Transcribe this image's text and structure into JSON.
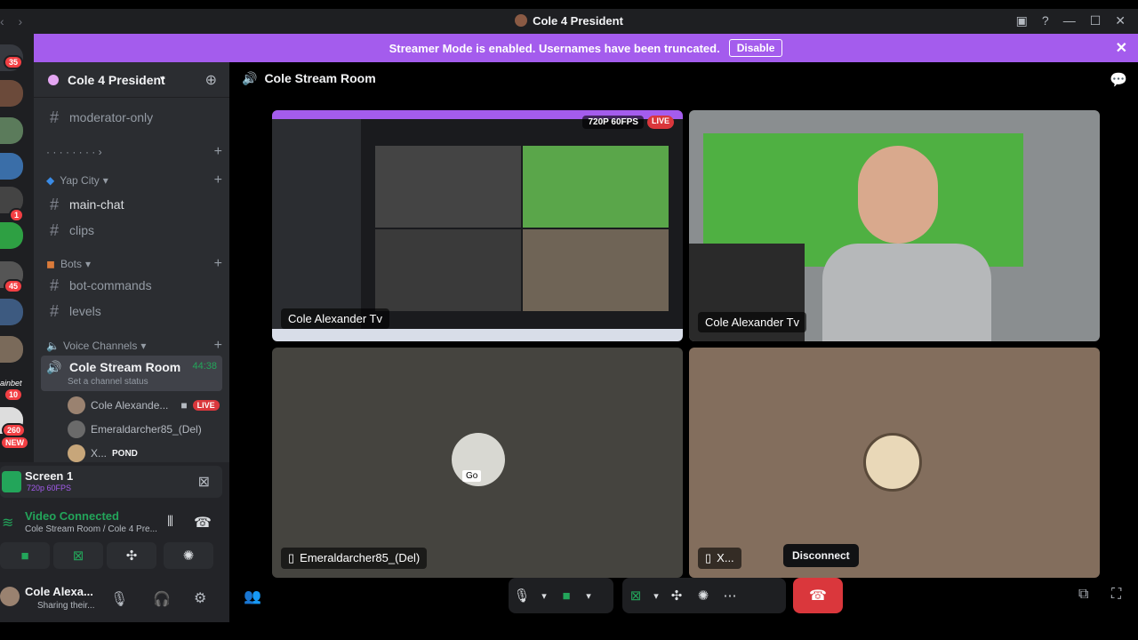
{
  "window": {
    "title": "Cole 4 President"
  },
  "banner": {
    "text": "Streamer Mode is enabled. Usernames have been truncated.",
    "button": "Disable"
  },
  "servers": {
    "badges": [
      "35",
      "1",
      "45",
      "10",
      "260",
      "NEW"
    ],
    "label_partial": "ainbet"
  },
  "server": {
    "name": "Cole 4 President"
  },
  "channels": {
    "moderator": "moderator-only",
    "dots": "· · · · · · · · ›",
    "cat_yap": "Yap City",
    "main_chat": "main-chat",
    "clips": "clips",
    "cat_bots": "Bots",
    "bot_commands": "bot-commands",
    "levels": "levels",
    "cat_voice": "Voice Channels",
    "voice_room": "Cole Stream Room",
    "timer": "44:38",
    "status": "Set a channel status",
    "members": [
      {
        "name": "Cole Alexande...",
        "live": "LIVE"
      },
      {
        "name": "Emeraldarcher85_(Del)"
      },
      {
        "name": "X...",
        "extra": "POND"
      }
    ]
  },
  "panel": {
    "screen": "Screen 1",
    "screen_quality": "720p 60FPS",
    "connected": "Video Connected",
    "connected_sub": "Cole Stream Room / Cole 4 Pre...",
    "user_name": "Cole Alexa...",
    "user_status": "Sharing their..."
  },
  "main": {
    "channel_title": "Cole Stream Room",
    "tiles": [
      {
        "label": "Cole Alexander Tv",
        "stream_quality": "720P 60FPS",
        "live": "LIVE"
      },
      {
        "label": "Cole Alexander Tv"
      },
      {
        "label": "Emeraldarcher85_(Del)",
        "avatar_text": "Go"
      },
      {
        "label": "X..."
      }
    ],
    "tooltip": "Disconnect"
  },
  "colors": {
    "accent": "#a45ced",
    "live": "#da373c",
    "connected": "#23a55a",
    "disconnect": "#da373c"
  }
}
